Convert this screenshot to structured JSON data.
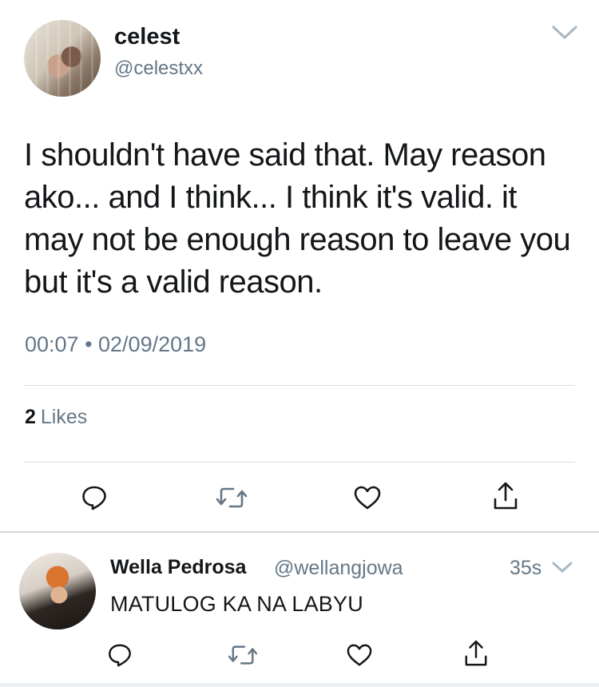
{
  "tweet": {
    "display_name": "celest",
    "handle": "@celestxx",
    "text": "I shouldn't have said that. May reason ako... and I think... I think it's valid. it may not be enough reason to leave you but it's a valid reason.",
    "timestamp": "00:07 • 02/09/2019",
    "likes_count": "2",
    "likes_label": "Likes"
  },
  "reply": {
    "display_name": "Wella Pedrosa",
    "handle": "@wellangjowa",
    "time": "35s",
    "text": "MATULOG KA NA LABYU"
  },
  "icons": {
    "reply": "reply-icon",
    "retweet": "retweet-icon",
    "like": "heart-icon",
    "share": "share-icon",
    "more": "chevron-down-icon"
  },
  "colors": {
    "primary_text": "#14171a",
    "secondary_text": "#657786",
    "divider": "#d9dee2"
  }
}
